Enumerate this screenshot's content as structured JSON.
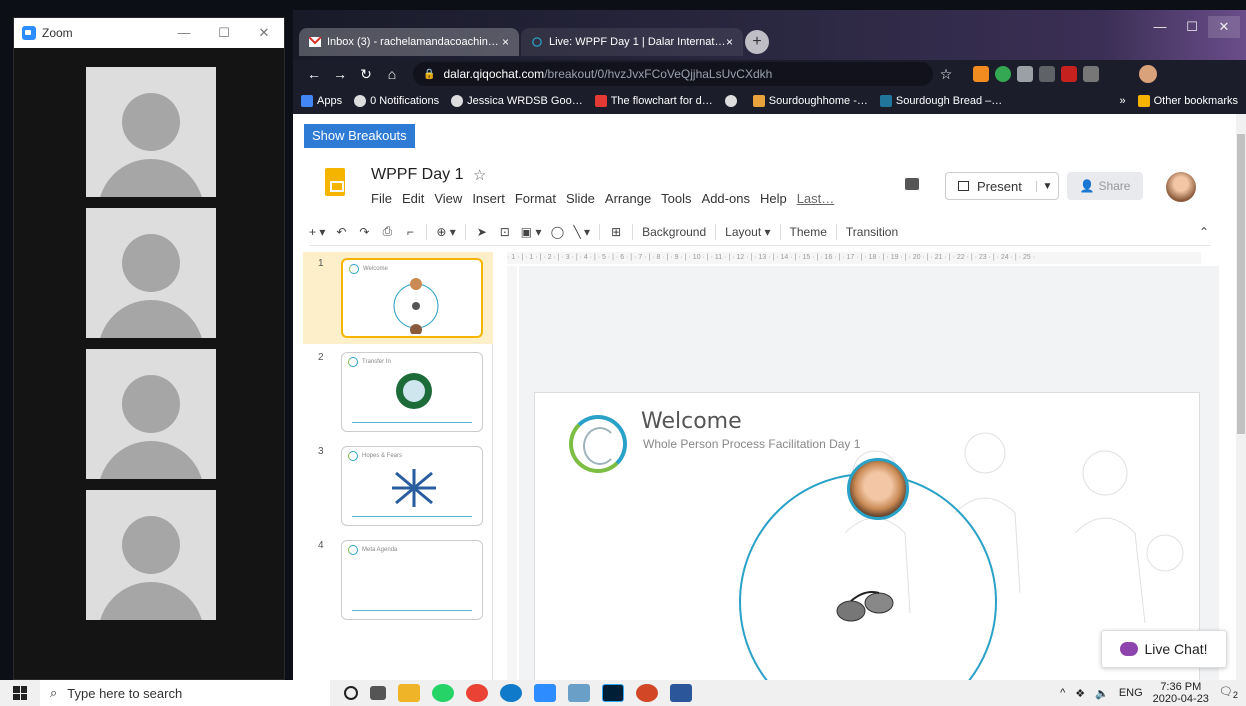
{
  "zoom": {
    "title": "Zoom",
    "controls": [
      "—",
      "☐",
      "✕"
    ],
    "participants": 4
  },
  "chrome": {
    "tabs": [
      {
        "label": "Inbox (3) - rachelamandacoachin…",
        "close": "×"
      },
      {
        "label": "Live: WPPF Day 1 | Dalar Internat…",
        "close": "×"
      }
    ],
    "new_tab": "+",
    "window_controls": [
      "—",
      "☐",
      "✕"
    ],
    "url_host": "dalar.qiqochat.com",
    "url_path": "/breakout/0/hvzJvxFCoVeQjjhaLsUvCXdkh",
    "bookmarks": [
      {
        "label": "Apps"
      },
      {
        "label": "0 Notifications"
      },
      {
        "label": "Jessica WRDSB Goo…"
      },
      {
        "label": "The flowchart for d…"
      },
      {
        "label": ""
      },
      {
        "label": "Sourdoughhome -…"
      },
      {
        "label": "Sourdough Bread –…"
      }
    ],
    "bookmarks_more": "»",
    "other_bookmarks": "Other bookmarks"
  },
  "page": {
    "show_breakouts": "Show Breakouts",
    "doc_title": "WPPF Day 1",
    "menu": [
      "File",
      "Edit",
      "View",
      "Insert",
      "Format",
      "Slide",
      "Arrange",
      "Tools",
      "Add-ons",
      "Help"
    ],
    "last_edit": "Last…",
    "present": "Present",
    "share": "Share",
    "toolbar": {
      "background": "Background",
      "layout": "Layout ▾",
      "theme": "Theme",
      "transition": "Transition"
    },
    "ruler_marks": "· 1 · | · 1 · | · 2 · | · 3 · | · 4 · | · 5 · | · 6 · | · 7 · | · 8 · | · 9 · | · 10 · | · 11 · | · 12 · | · 13 · | · 14 · | · 15 · | · 16 · | · 17 · | · 18 · | · 19 · | · 20 · | · 21 · | · 22 · | · 23 · | · 24 · | · 25 ·",
    "slides": [
      {
        "num": "1",
        "title": "Welcome"
      },
      {
        "num": "2",
        "title": "Transfer In"
      },
      {
        "num": "3",
        "title": "Hopes & Fears"
      },
      {
        "num": "4",
        "title": "Meta Agenda"
      }
    ],
    "slide_main": {
      "title": "Welcome",
      "subtitle": "Whole Person Process Facilitation Day 1"
    },
    "live_chat": "Live Chat!"
  },
  "taskbar": {
    "search_placeholder": "Type here to search",
    "lang": "ENG",
    "time": "7:36 PM",
    "date": "2020-04-23",
    "notifications": "2"
  },
  "colors": {
    "accent_blue": "#2d7bd5",
    "slides_yellow": "#f4b400",
    "ring_teal": "#2aa1c7",
    "ring_green": "#7bbe43",
    "chat_purple": "#8e44ad"
  }
}
